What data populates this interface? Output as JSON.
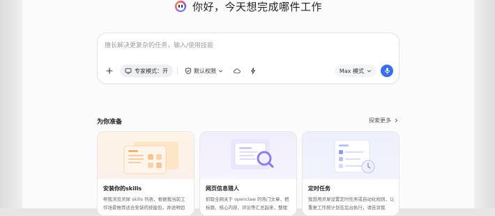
{
  "greeting": {
    "text": "你好，今天想完成哪件工作"
  },
  "composer": {
    "placeholder": "擅长解决更复杂的任务，输入/使用技能",
    "expert_mode_label": "专家模式：开",
    "permission_label": "默认权限",
    "model_mode_label": "Max 模式"
  },
  "section": {
    "title": "为你准备",
    "explore_label": "探索更多"
  },
  "cards": [
    {
      "title": "安装你的skills",
      "desc": "帮我浏览灵犀 skills 列表，根据我当前工作场景推荐适合安装的技能包，并说明如"
    },
    {
      "title": "网页信息猎人",
      "desc": "抓取全网关于 openclaw 的热门文章，把标题、核心内容、评论等汇总起来，整理"
    },
    {
      "title": "定时任务",
      "desc": "我想用灵犀设置定时任务或自动化规则，让重复工作按计划在后台执行，请告诉我"
    }
  ],
  "colors": {
    "accent": "#3b6fe6",
    "card_orange": "#f2b272",
    "card_purple": "#8d7ce8",
    "card_blue": "#6f85e6"
  }
}
